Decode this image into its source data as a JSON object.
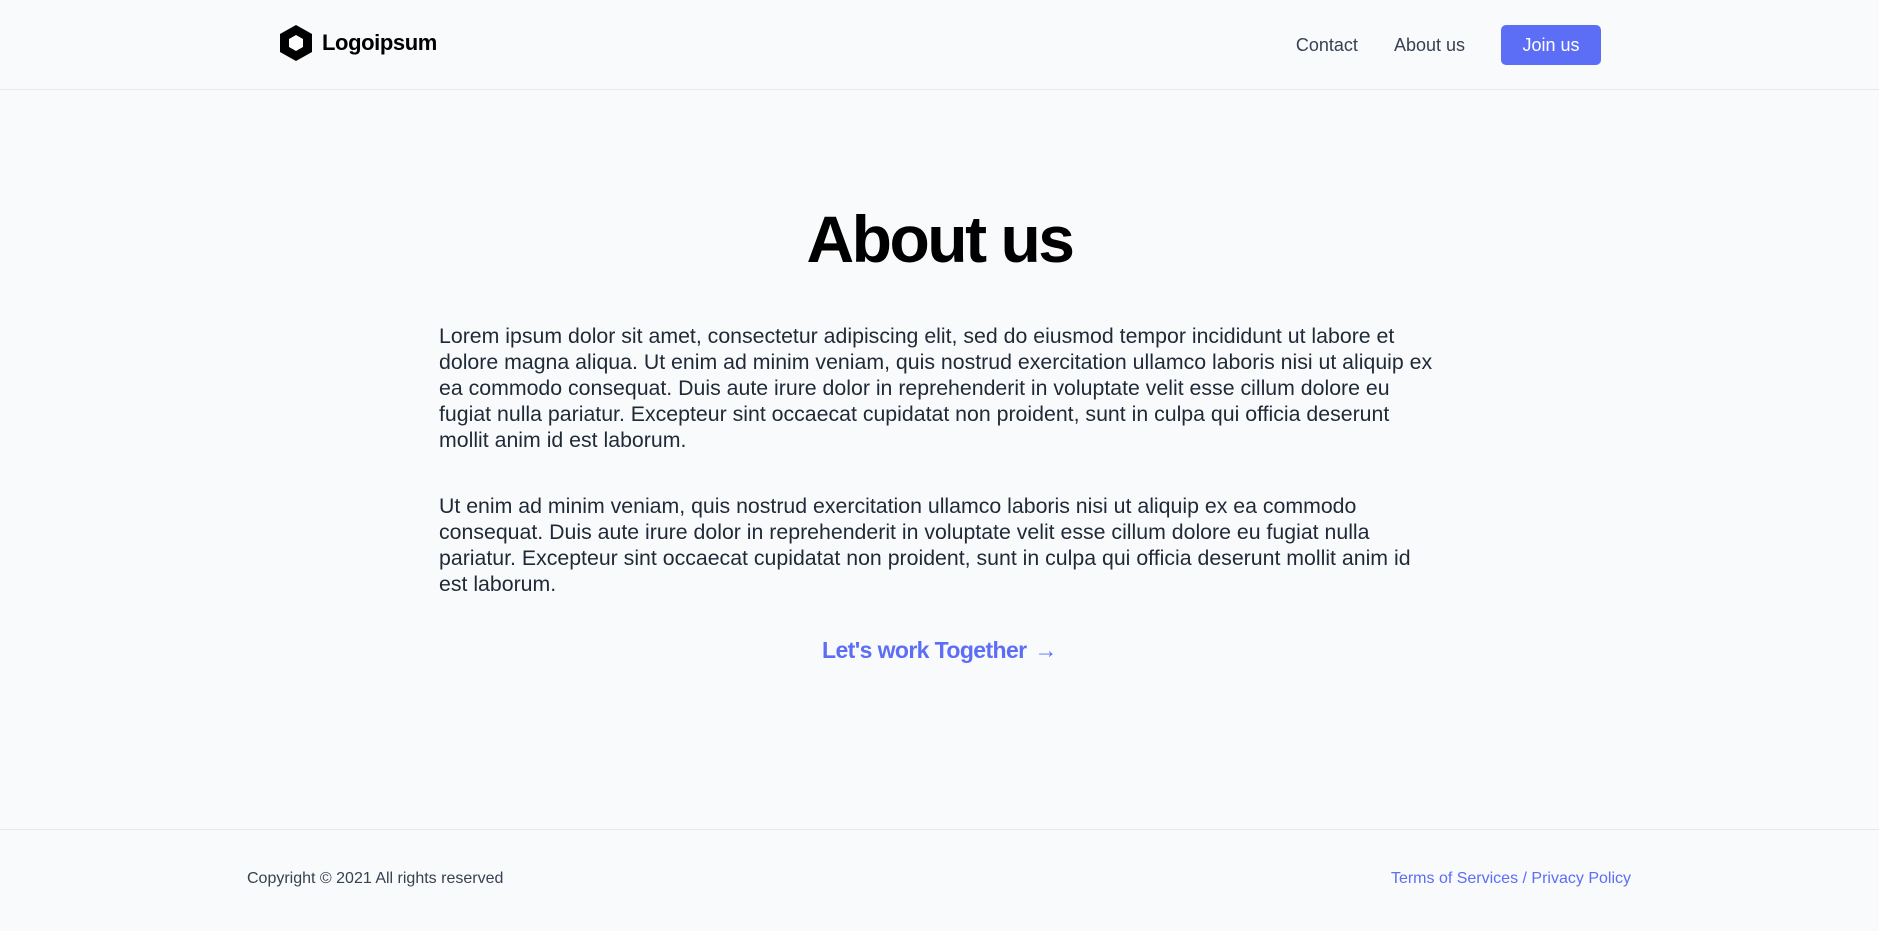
{
  "header": {
    "logo_text": "Logoipsum",
    "nav": {
      "contact": "Contact",
      "about": "About us",
      "join": "Join us"
    }
  },
  "main": {
    "title": "About us",
    "paragraphs": [
      "Lorem ipsum dolor sit amet, consectetur adipiscing elit, sed do eiusmod tempor incididunt ut labore et dolore magna aliqua. Ut enim ad minim veniam, quis nostrud exercitation ullamco laboris nisi ut aliquip ex ea commodo consequat. Duis aute irure dolor in reprehenderit in voluptate velit esse cillum dolore eu fugiat nulla pariatur. Excepteur sint occaecat cupidatat non proident, sunt in culpa qui officia deserunt mollit anim id est laborum.",
      "Ut enim ad minim veniam, quis nostrud exercitation ullamco laboris nisi ut aliquip ex ea commodo consequat. Duis aute irure dolor in reprehenderit in voluptate velit esse cillum dolore eu fugiat nulla pariatur. Excepteur sint occaecat cupidatat non proident, sunt in culpa qui officia deserunt mollit anim id est laborum."
    ],
    "cta_label": "Let's work Together",
    "cta_arrow": "→"
  },
  "footer": {
    "copyright": "Copyright © 2021 All rights reserved",
    "terms": "Terms of Services",
    "separator": " / ",
    "privacy": "Privacy Policy"
  },
  "colors": {
    "accent": "#5b6ef5",
    "background": "#f9fafb",
    "text": "#1f2937"
  },
  "icons": {
    "logo": "hexagon-logo-icon",
    "cta": "arrow-right-icon"
  }
}
